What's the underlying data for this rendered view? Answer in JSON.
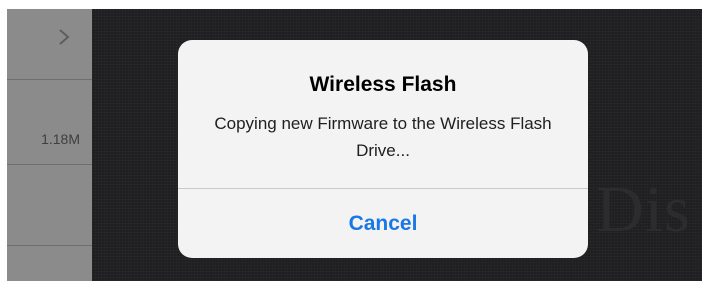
{
  "colors": {
    "overlay_dark": "#1f1f21",
    "side_panel": "#8b8b8b",
    "alert_bg": "#f3f3f3",
    "accent_blue": "#1a78e6"
  },
  "side_list": {
    "rows": [
      {
        "icon": "chevron-right-icon"
      },
      {
        "size": "1.18M"
      },
      {}
    ]
  },
  "background": {
    "logo_text": "Dis"
  },
  "alert": {
    "title": "Wireless Flash",
    "message": "Copying new Firmware to the Wireless Flash Drive...",
    "cancel_label": "Cancel"
  }
}
